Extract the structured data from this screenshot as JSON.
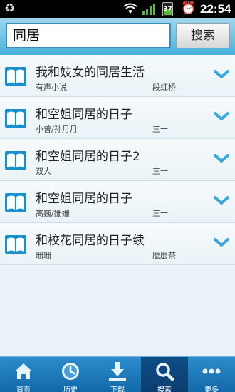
{
  "status_bar": {
    "battery": "37",
    "time": "22:54"
  },
  "search": {
    "query": "同居",
    "button_label": "搜索"
  },
  "results": [
    {
      "title": "我和妓女的同居生活",
      "author": "有声小说",
      "reader": "段红桥"
    },
    {
      "title": "和空姐同居的日子",
      "author": "小曾/孙月月",
      "reader": "三十"
    },
    {
      "title": "和空姐同居的日子2",
      "author": "双人",
      "reader": "三十"
    },
    {
      "title": "和空姐同居的日子",
      "author": "高巍/姗姗",
      "reader": "三十"
    },
    {
      "title": "和校花同居的日子续",
      "author": "珊珊",
      "reader": "麽麽茶"
    }
  ],
  "bottom_nav": [
    {
      "label": "首页",
      "icon": "home-icon"
    },
    {
      "label": "历史",
      "icon": "clock-icon"
    },
    {
      "label": "下载",
      "icon": "download-icon"
    },
    {
      "label": "搜索",
      "icon": "search-icon",
      "active": true
    },
    {
      "label": "更多",
      "icon": "more-icon"
    }
  ],
  "colors": {
    "accent": "#2a86c8",
    "nav_active": "#0d4d86",
    "chevron": "#3aa8dc"
  }
}
